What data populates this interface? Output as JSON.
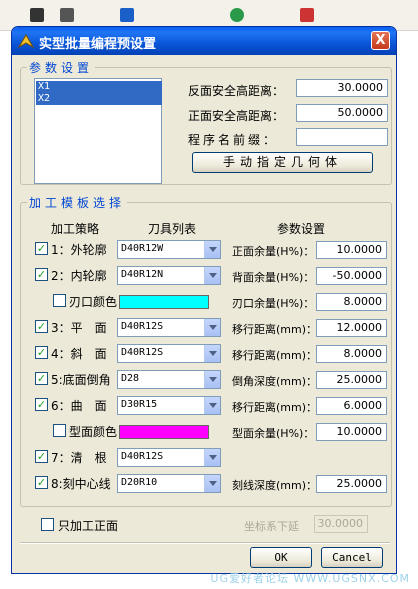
{
  "window": {
    "title": "实型批量编程预设置",
    "close_glyph": "X"
  },
  "params_group": {
    "title": "参数设置",
    "list_items": [
      "X1",
      "X2"
    ],
    "fields": [
      {
        "label": "反面安全高距离：",
        "value": "30.0000"
      },
      {
        "label": "正面安全高距离：",
        "value": "50.0000"
      },
      {
        "label": "程序名前缀：",
        "value": ""
      }
    ],
    "geometry_button": "手动指定几何体"
  },
  "template_group": {
    "title": "加工模板选择",
    "headers": {
      "strategy": "加工策略",
      "tools": "刀具列表",
      "params": "参数设置"
    },
    "rows": [
      {
        "checked": true,
        "label": "1：外轮廓",
        "tool": "D40R12W",
        "param_label": "正面余量(H%)：",
        "param_value": "10.0000"
      },
      {
        "checked": true,
        "label": "2：内轮廓",
        "tool": "D40R12N",
        "param_label": "背面余量(H%)：",
        "param_value": "-50.0000"
      },
      {
        "checked": false,
        "label": "刃口颜色",
        "color": "#00ffff",
        "param_label": "刃口余量(H%)：",
        "param_value": "8.0000"
      },
      {
        "checked": true,
        "label": "3：平　面",
        "tool": "D40R12S",
        "param_label": "移行距离(mm)：",
        "param_value": "12.0000"
      },
      {
        "checked": true,
        "label": "4：斜　面",
        "tool": "D40R12S",
        "param_label": "移行距离(mm)：",
        "param_value": "8.0000"
      },
      {
        "checked": true,
        "label": "5:底面倒角",
        "tool": "D28",
        "param_label": "倒角深度(mm)：",
        "param_value": "25.0000"
      },
      {
        "checked": true,
        "label": "6：曲　面",
        "tool": "D30R15",
        "param_label": "移行距离(mm)：",
        "param_value": "6.0000"
      },
      {
        "checked": false,
        "label": "型面颜色",
        "color": "#ff00ff",
        "param_label": "型面余量(H%)：",
        "param_value": "10.0000"
      },
      {
        "checked": true,
        "label": "7：清　根",
        "tool": "D40R12S"
      },
      {
        "checked": true,
        "label": "8:刻中心线",
        "tool": "D20R10",
        "param_label": "刻线深度(mm)：",
        "param_value": "25.0000"
      }
    ]
  },
  "bottom": {
    "front_only_label": "只加工正面",
    "front_only_checked": false,
    "coord_label": "坐标系下延",
    "coord_value": "30.0000",
    "ok": "OK",
    "cancel": "Cancel"
  },
  "watermark": "UG爱好者论坛 WWW.UGSNX.COM"
}
